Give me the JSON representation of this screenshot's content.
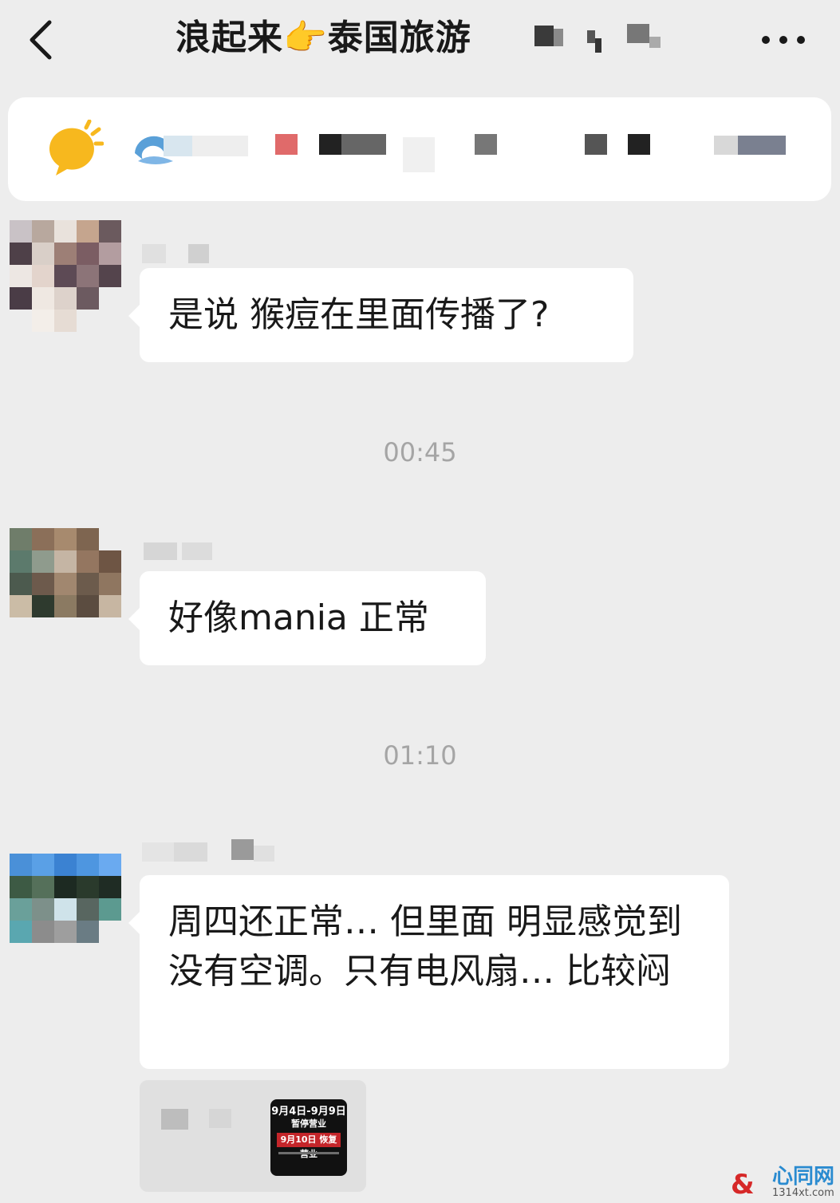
{
  "header": {
    "title": "浪起来👉泰国旅游"
  },
  "messages": [
    {
      "text": "是说 猴痘在里面传播了?"
    },
    {
      "text": "好像mania 正常"
    },
    {
      "text": "周四还正常… 但里面 明显感觉到 没有空调。只有电风扇… 比较闷"
    }
  ],
  "timestamps": [
    "00:45",
    "01:10"
  ],
  "notice_image": {
    "line1": "9月4日-9月9日",
    "line2": "暂停营业",
    "line3": "9月10日 恢复营业"
  },
  "watermark": {
    "brand": "心同网",
    "url": "1314xt.com"
  },
  "colors": {
    "background": "#ededed",
    "bubble": "#ffffff",
    "timestamp": "#a5a5a5",
    "notice_red": "#c4252a"
  },
  "icons": [
    "back-arrow-icon",
    "more-dots-icon",
    "sun-icon"
  ]
}
